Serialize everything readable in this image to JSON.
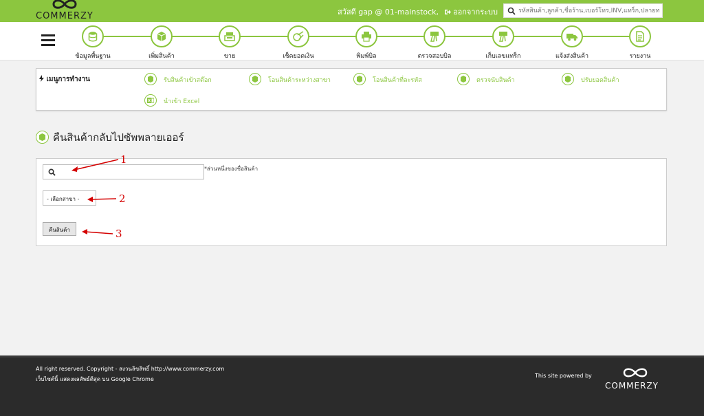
{
  "header": {
    "logo_text": "COMMERZY",
    "greeting": "สวัสดี gap @ 01-mainstock,",
    "logout": "ออกจากระบบ",
    "search_placeholder": "รหัสสินค้า,ลูกค้า,ชื่อร้าน,เบอร์โทร,INV,แทร็ก,ปลายทาง"
  },
  "nav": {
    "items": [
      {
        "label": "ข้อมูลพื้นฐาน",
        "icon": "database-icon"
      },
      {
        "label": "เพิ่มสินค้า",
        "icon": "box-icon"
      },
      {
        "label": "ขาย",
        "icon": "cash-register-icon"
      },
      {
        "label": "เช็คยอดเงิน",
        "icon": "check-money-icon"
      },
      {
        "label": "พิมพ์บิล",
        "icon": "printer-icon"
      },
      {
        "label": "ตรวจสอบบิล",
        "icon": "scan-bill-icon"
      },
      {
        "label": "เก็บเลขแทร็ก",
        "icon": "scan-track-icon"
      },
      {
        "label": "แจ้งส่งสินค้า",
        "icon": "truck-icon"
      },
      {
        "label": "รายงาน",
        "icon": "report-icon"
      }
    ]
  },
  "work_menu": {
    "title": "เมนูการทำงาน",
    "items": [
      {
        "label": "รับสินค้าเข้าสต๊อก"
      },
      {
        "label": "โอนสินค้าระหว่างสาขา"
      },
      {
        "label": "โอนสินค้าที่ละรหัส"
      },
      {
        "label": "ตรวจนับสินค้า"
      },
      {
        "label": "ปรับยอดสินค้า"
      },
      {
        "label": "นำเข้า Excel"
      }
    ]
  },
  "page": {
    "title": "คืนสินค้ากลับไปซัพพลายเออร์"
  },
  "form": {
    "search_value": "",
    "hint": "*ส่วนหนึ่งของชื่อสินค้า",
    "branch_selected": "- เลือกสาขา -",
    "return_button": "คืนสินค้า"
  },
  "annotations": {
    "n1": "1",
    "n2": "2",
    "n3": "3",
    "color": "#d40000"
  },
  "footer": {
    "line1": "All right reserved. Copyright - สงวนลิขสิทธิ์ http://www.commerzy.com",
    "line2": "เว็บไซต์นี้ แสดงผลสัพธ์ดีสุด บน Google Chrome",
    "powered": "This site powered by",
    "logo_text": "COMMERZY"
  },
  "colors": {
    "accent": "#8cc63f",
    "footer_bg": "#2b2b2b"
  }
}
